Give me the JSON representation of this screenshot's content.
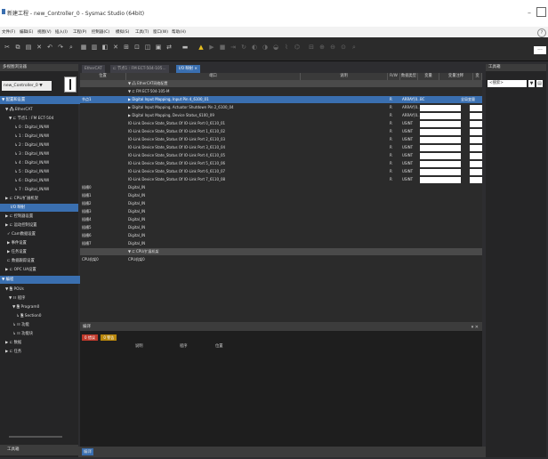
{
  "window": {
    "title": "新建工程 - new_Controller_0 - Sysmac Studio (64bit)",
    "minimize": "–"
  },
  "menubar": {
    "items": [
      "文件(F)",
      "编辑(E)",
      "视图(V)",
      "插入(I)",
      "工程(P)",
      "控制器(C)",
      "模拟(S)",
      "工具(T)",
      "窗口(W)",
      "帮助(H)"
    ],
    "help": "?"
  },
  "toolbar": {
    "more": "..."
  },
  "left": {
    "header": "多视图浏览器",
    "controller": "new_Controller_0 ▼",
    "tree": [
      "▼ 配置和设置",
      "▼ 🖧 EtherCAT",
      "▼ ⊏ 节点1 : FM ECT-504",
      "↳ 0 : Digital_IN/WI",
      "↳ 1 : Digital_IN/WI",
      "↳ 2 : Digital_IN/WI",
      "↳ 3 : Digital_IN/WI",
      "↳ 4 : Digital_IN/WI",
      "↳ 5 : Digital_IN/WI",
      "↳ 6 : Digital_IN/WI",
      "↳ 7 : Digital_IN/WI",
      "▶ ⊏ CPU/扩展机架",
      "I/O 映射",
      "▶ ⊏ 控制器设置",
      "▶ ⊏ 运动控制设置",
      "✓ Cam数据设置",
      "▶ 事件设置",
      "▶ 任务设置",
      "⊏ 数据跟踪设置",
      "▶ ⊏ OPC UA设置",
      "▼ 编程",
      "▼ 🗎 POUs",
      "▼ ☷ 程序",
      "▼ 🗎 Program0",
      "↳ 🗎 Section0",
      "↳ ☷ 功能",
      "↳ ☷ 功能块",
      "▶ ⊏ 数据",
      "▶ ⊏ 任务"
    ],
    "footer": "工具箱"
  },
  "center": {
    "tabs": [
      "EtherCAT",
      "⊏ 节点1 : FM ECT-504-105...",
      "I/O 映射 ×"
    ],
    "columns": [
      "位置",
      "端口",
      "说明",
      "R/W",
      "数据类型",
      "变量",
      "变量注释",
      "变"
    ],
    "rows": [
      {
        "pos": "",
        "port": "▼ 🖧 EtherCAT网络配置",
        "rw": "",
        "type": "",
        "style": "dark"
      },
      {
        "pos": "",
        "port": "▼ ⊏ FM ECT-504-105-M",
        "rw": "",
        "type": "",
        "style": ""
      },
      {
        "pos": "节点1",
        "port": "▶ Digital Input Mapping, Input Pin 4_6100_01",
        "rw": "R",
        "type": "ARRAY[0..7]",
        "var": "BC",
        "comment": "全局变量",
        "style": "hl"
      },
      {
        "pos": "",
        "port": "▶ Digital Input Mapping, Actuator Shutdown Pin 2_6100_04",
        "rw": "R",
        "type": "ARRAY[0..7]",
        "style": ""
      },
      {
        "pos": "",
        "port": "▶ Digital Input Mapping, Device Status_6100_09",
        "rw": "R",
        "type": "ARRAY[0..7]",
        "style": ""
      },
      {
        "pos": "",
        "port": "IO-Link Device State_Status Of IO-Link Port 0_6110_01",
        "rw": "R",
        "type": "USINT",
        "style": ""
      },
      {
        "pos": "",
        "port": "IO-Link Device State_Status Of IO-Link Port 1_6110_02",
        "rw": "R",
        "type": "USINT",
        "style": ""
      },
      {
        "pos": "",
        "port": "IO-Link Device State_Status Of IO-Link Port 2_6110_03",
        "rw": "R",
        "type": "USINT",
        "style": ""
      },
      {
        "pos": "",
        "port": "IO-Link Device State_Status Of IO-Link Port 3_6110_04",
        "rw": "R",
        "type": "USINT",
        "style": ""
      },
      {
        "pos": "",
        "port": "IO-Link Device State_Status Of IO-Link Port 4_6110_05",
        "rw": "R",
        "type": "USINT",
        "style": ""
      },
      {
        "pos": "",
        "port": "IO-Link Device State_Status Of IO-Link Port 5_6110_06",
        "rw": "R",
        "type": "USINT",
        "style": ""
      },
      {
        "pos": "",
        "port": "IO-Link Device State_Status Of IO-Link Port 6_6110_07",
        "rw": "R",
        "type": "USINT",
        "style": ""
      },
      {
        "pos": "",
        "port": "IO-Link Device State_Status Of IO-Link Port 7_6110_08",
        "rw": "R",
        "type": "USINT",
        "style": ""
      },
      {
        "pos": "插槽0",
        "port": "Digital_IN",
        "rw": "",
        "type": "",
        "style": ""
      },
      {
        "pos": "插槽1",
        "port": "Digital_IN",
        "rw": "",
        "type": "",
        "style": ""
      },
      {
        "pos": "插槽2",
        "port": "Digital_IN",
        "rw": "",
        "type": "",
        "style": ""
      },
      {
        "pos": "插槽3",
        "port": "Digital_IN",
        "rw": "",
        "type": "",
        "style": ""
      },
      {
        "pos": "插槽4",
        "port": "Digital_IN",
        "rw": "",
        "type": "",
        "style": ""
      },
      {
        "pos": "插槽5",
        "port": "Digital_IN",
        "rw": "",
        "type": "",
        "style": ""
      },
      {
        "pos": "插槽6",
        "port": "Digital_IN",
        "rw": "",
        "type": "",
        "style": ""
      },
      {
        "pos": "插槽7",
        "port": "Digital_IN",
        "rw": "",
        "type": "",
        "style": ""
      },
      {
        "pos": "",
        "port": "▼ ⊏ CPU/扩展机架",
        "rw": "",
        "type": "",
        "style": "dark"
      },
      {
        "pos": "CPU机架0",
        "port": "CPU机架0",
        "rw": "",
        "type": "",
        "style": ""
      }
    ],
    "build": {
      "title": "编译",
      "badges": [
        "0 错误",
        "0 警告"
      ],
      "columns": [
        "说明",
        "程序",
        "位置"
      ],
      "close": "▾ ✕"
    },
    "status_tab": "编译"
  },
  "right": {
    "header": "工具箱",
    "search": "<搜索>",
    "btn1": "▼",
    "btn2": "▤"
  }
}
